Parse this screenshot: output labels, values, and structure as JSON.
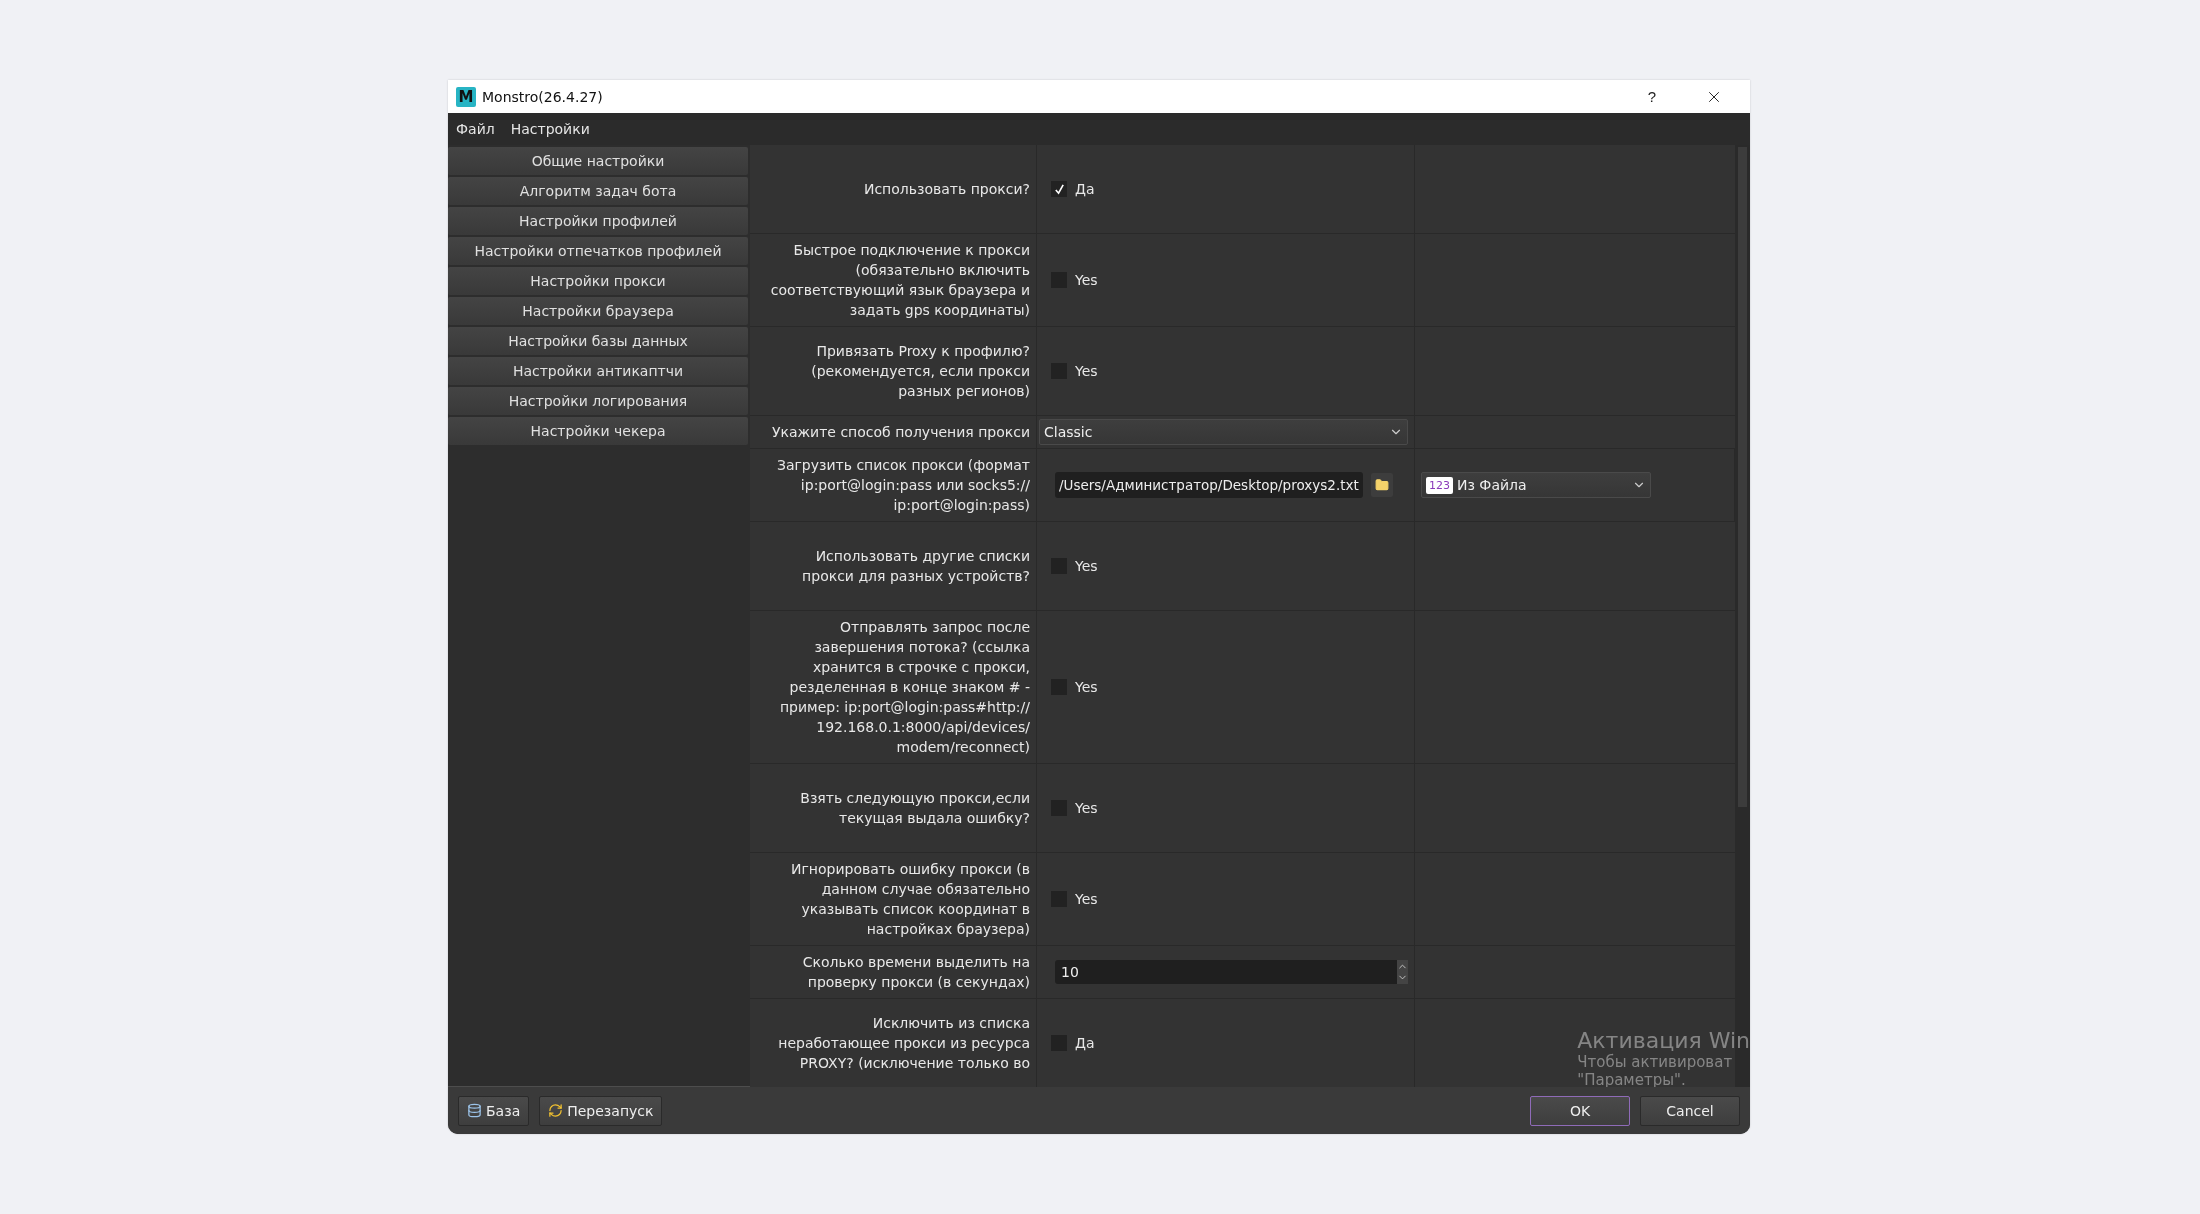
{
  "window": {
    "title": "Monstro(26.4.27)",
    "logo_text": "M",
    "help": "?"
  },
  "menu": [
    "Файл",
    "Настройки"
  ],
  "sidebar": {
    "items": [
      {
        "label": "Общие настройки"
      },
      {
        "label": "Алгоритм задач бота"
      },
      {
        "label": "Настройки профилей"
      },
      {
        "label": "Настройки отпечатков профилей"
      },
      {
        "label": "Настройки прокси"
      },
      {
        "label": "Настройки браузера"
      },
      {
        "label": "Настройки базы данных"
      },
      {
        "label": "Настройки антикаптчи"
      },
      {
        "label": "Настройки логирования"
      },
      {
        "label": "Настройки чекера"
      }
    ]
  },
  "settings": [
    {
      "kind": "checkbox",
      "label": "Использовать прокси?",
      "checked": true,
      "option": "Да"
    },
    {
      "kind": "checkbox",
      "label": "Быстрое подключение к прокси (обязательно включить соответствующий язык браузера и задать gps координаты)",
      "checked": false,
      "option": "Yes"
    },
    {
      "kind": "checkbox",
      "label": "Привязать Proxy к профилю? (рекомендуется, если прокси разных регионов)",
      "checked": false,
      "option": "Yes"
    },
    {
      "kind": "select",
      "label": "Укажите способ получения прокси",
      "value": "Classic"
    },
    {
      "kind": "file",
      "label": "Загрузить список прокси (формат ip:port@login:pass или socks5:// ip:port@login:pass)",
      "value": "/Users/Администратор/Desktop/proxys2.txt",
      "source": {
        "badge": "123",
        "value": "Из Файла"
      }
    },
    {
      "kind": "checkbox",
      "label": "Использовать другие списки прокси для разных устройств?",
      "checked": false,
      "option": "Yes"
    },
    {
      "kind": "checkbox",
      "label": "Отправлять запрос после завершения потока? (ссылка хранится в строчке с прокси, резделенная в конце знаком # - пример: ip:port@login:pass#http:// 192.168.0.1:8000/api/devices/ modem/reconnect)",
      "checked": false,
      "option": "Yes"
    },
    {
      "kind": "checkbox",
      "label": "Взять следующую прокси,если текущая выдала ошибку?",
      "checked": false,
      "option": "Yes"
    },
    {
      "kind": "checkbox",
      "label": "Игнорировать ошибку прокси (в данном случае обязательно указывать список координат в настройках браузера)",
      "checked": false,
      "option": "Yes"
    },
    {
      "kind": "number",
      "label": "Сколько времени выделить на проверку прокси (в секундах)",
      "value": "10"
    },
    {
      "kind": "checkbox",
      "label": "Исключить из списка неработающее прокси из ресурса PROXY? (исключение только во",
      "checked": false,
      "option": "Да"
    }
  ],
  "os_notice": {
    "title": "Активация Win",
    "lines": [
      "Чтобы активироват",
      "\"Параметры\"."
    ]
  },
  "footer": {
    "left_buttons": [
      {
        "kind": "database",
        "label": "База"
      },
      {
        "kind": "restart",
        "label": "Перезапуск"
      }
    ],
    "ok": "OK",
    "cancel": "Cancel"
  }
}
